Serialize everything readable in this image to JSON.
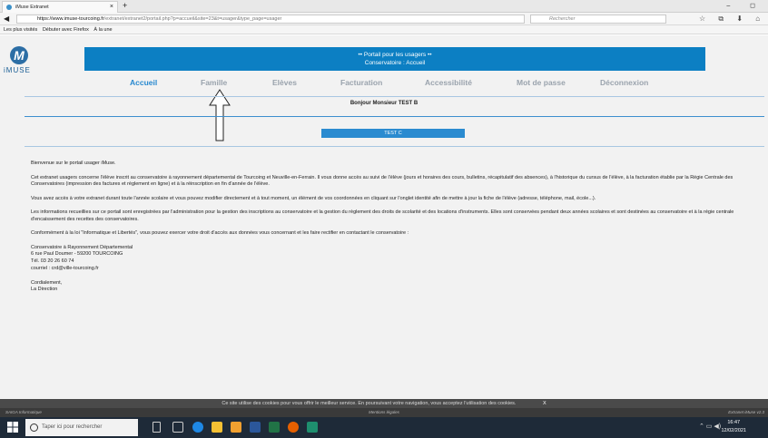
{
  "browser": {
    "tab_title": "iMuse Extranet",
    "tab_close": "×",
    "new_tab": "+",
    "window_controls": "– ◻",
    "url_host": "https://www.imuse-tourcoing.fr",
    "url_path": "/extranet/extranet2/portail.php?p=accueil&site=23&t=usager&type_page=usager",
    "search_placeholder": "Rechercher",
    "bookmarks": [
      "Les plus visités",
      "Débuter avec Firefox",
      "À la une"
    ]
  },
  "logo": {
    "letter": "M",
    "word": "iMUSE"
  },
  "banner": {
    "line1": "•• Portail pour les usagers ••",
    "line2": "Conservatoire : Accueil"
  },
  "nav": {
    "items": [
      {
        "label": "Accueil"
      },
      {
        "label": "Famille"
      },
      {
        "label": "Elèves"
      },
      {
        "label": "Facturation"
      },
      {
        "label": "Accessibilité"
      },
      {
        "label": "Mot de passe"
      },
      {
        "label": "Déconnexion"
      }
    ]
  },
  "greeting": "Bonjour Monsieur TEST B",
  "student_selector": "TEST C",
  "content": {
    "p1": "Bienvenue sur le portail usager iMuse.",
    "p2": "Cet extranet usagers concerne l'élève inscrit au conservatoire à rayonnement départemental de Tourcoing et Neuville-en-Ferrain. Il vous donne accès au suivi de l'élève (jours et horaires des cours, bulletins, récapitulatif des absences), à l'historique du cursus de l'élève, à la facturation établie par la Régie Centrale des Conservatoires (impression des factures et règlement en ligne) et à la réinscription en fin d'année de l'élève.",
    "p3": "Vous avez accès à votre extranet durant toute l'année scolaire et vous pouvez modifier directement et à tout moment, un élément de vos coordonnées en cliquant sur l'onglet identité afin de mettre à jour la fiche de l'élève (adresse, téléphone, mail, école...).",
    "p4": "Les informations recueillies sur ce portail sont enregistrées par l'administration pour la gestion des inscriptions au conservatoire et la gestion du règlement des droits de scolarité et des locations d'instruments. Elles sont conservées pendant deux années scolaires et sont destinées au conservatoire et à la régie centrale d'encaissement des recettes des conservatoires.",
    "p5": "Conformément à la loi \"Informatique et Libertés\", vous pouvez exercer votre droit d'accès aux données vous concernant et les faire rectifier en contactant le conservatoire :",
    "addr1": "Conservatoire à Rayonnement Départemental",
    "addr2": "6 rue Paul Doumer - 59200 TOURCOING",
    "addr3": "Tél. 03 20 26 60 74",
    "addr4": "courriel : crd@ville-tourcoing.fr",
    "sign1": "Cordialement,",
    "sign2": "La Direction"
  },
  "cookie": {
    "text": "Ce site utilise des cookies pour vous offrir le meilleur service. En poursuivant votre navigation, vous acceptez l'utilisation des cookies.",
    "close": "X"
  },
  "footer": {
    "left": "SAIGA Informatique",
    "center": "Mentions légales",
    "right": "Extranet iMuse v2.3"
  },
  "taskbar": {
    "search_placeholder": "Taper ici pour rechercher",
    "time": "16:47",
    "date": "12/02/2021"
  },
  "colors": {
    "banner": "#0c7fc3",
    "nav_link": "#2788cf",
    "selector": "#2b8bd0"
  }
}
